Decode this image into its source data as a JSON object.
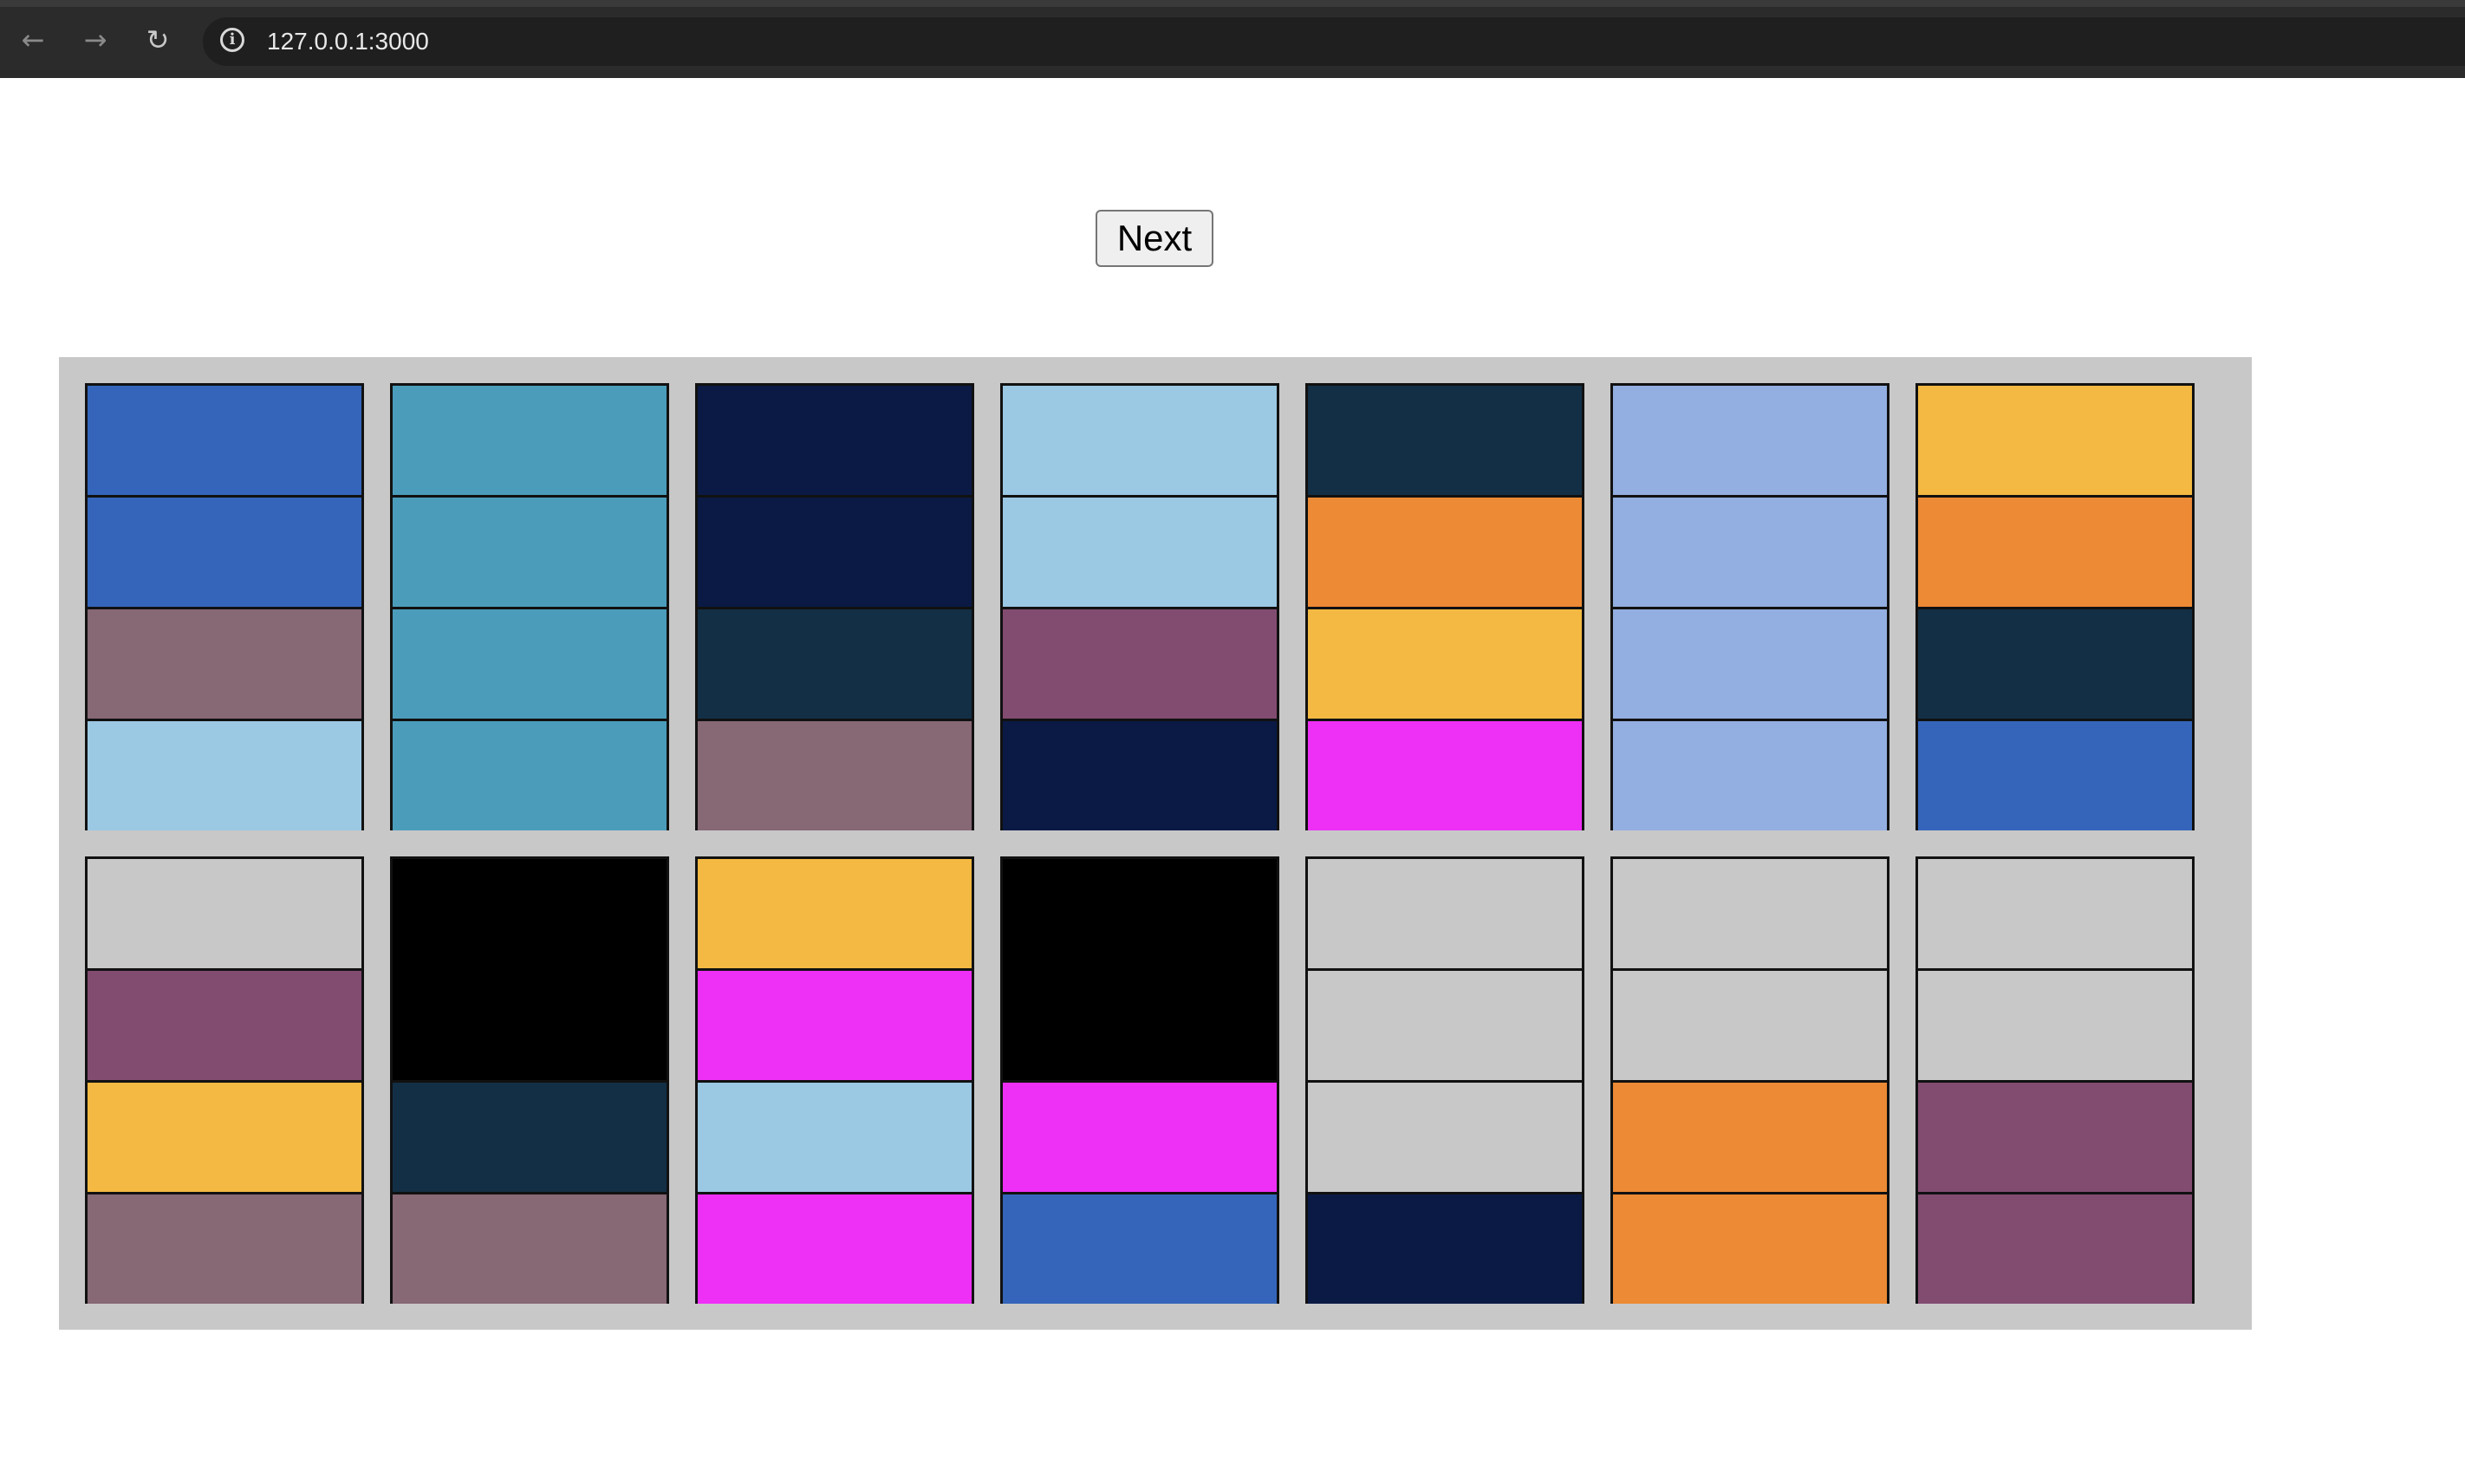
{
  "browser": {
    "url": "127.0.0.1:3000",
    "back_icon": "arrow-left",
    "forward_icon": "arrow-right",
    "reload_icon": "reload",
    "info_icon": "info-circle"
  },
  "controls": {
    "next_label": "Next"
  },
  "colors": {
    "board": "#c8c8c8",
    "empty": "#c8c8c8",
    "royal_blue": "#3565ba",
    "teal": "#4b9cba",
    "navy": "#0a1a45",
    "light_blue": "#9bc8e3",
    "dark_teal": "#132f45",
    "periwinkle": "#93aee0",
    "gold": "#f3b942",
    "orange": "#ec8a35",
    "mauve": "#876875",
    "plum": "#824c71",
    "magenta": "#ee2ff5",
    "black": "#000000"
  },
  "tubes": [
    [
      "royal_blue",
      "royal_blue",
      "mauve",
      "light_blue"
    ],
    [
      "teal",
      "teal",
      "teal",
      "teal"
    ],
    [
      "navy",
      "navy",
      "dark_teal",
      "mauve"
    ],
    [
      "light_blue",
      "light_blue",
      "plum",
      "navy"
    ],
    [
      "dark_teal",
      "orange",
      "gold",
      "magenta"
    ],
    [
      "periwinkle",
      "periwinkle",
      "periwinkle",
      "periwinkle"
    ],
    [
      "gold",
      "orange",
      "dark_teal",
      "royal_blue"
    ],
    [
      "empty",
      "plum",
      "gold",
      "mauve"
    ],
    [
      "black",
      "black",
      "dark_teal",
      "mauve"
    ],
    [
      "gold",
      "magenta",
      "light_blue",
      "magenta"
    ],
    [
      "black",
      "black",
      "magenta",
      "royal_blue"
    ],
    [
      "empty",
      "empty",
      "empty",
      "navy"
    ],
    [
      "empty",
      "empty",
      "orange",
      "orange"
    ],
    [
      "empty",
      "empty",
      "plum",
      "plum"
    ]
  ]
}
